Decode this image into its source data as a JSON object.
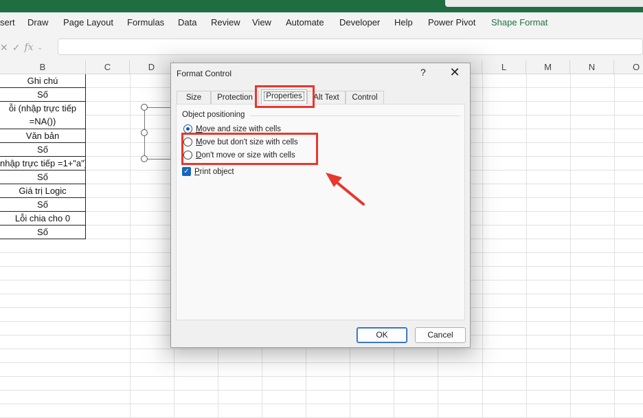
{
  "ribbon": {
    "tabs": [
      "sert",
      "Draw",
      "Page Layout",
      "Formulas",
      "Data",
      "Review",
      "View",
      "Automate",
      "Developer",
      "Help",
      "Power Pivot",
      "Shape Format"
    ]
  },
  "formula_bar": {
    "cancel_symbol": "✕",
    "enter_symbol": "✓",
    "fx_label": "fx",
    "value": ""
  },
  "grid": {
    "column_headers": [
      "B",
      "C",
      "D",
      "L",
      "M",
      "N",
      "O"
    ],
    "b_cells": [
      "Ghi chú",
      "Số",
      "ỗi (nhập trực tiếp =NA())",
      "Văn bản",
      "Số",
      "nhập trực tiếp =1+\"a\")",
      "Số",
      "Giá trị Logic",
      "Số",
      "Lỗi chia cho 0",
      "Số"
    ]
  },
  "dialog": {
    "title": "Format Control",
    "help": "?",
    "close": "✕",
    "tabs": [
      "Size",
      "Protection",
      "Properties",
      "Alt Text",
      "Control"
    ],
    "active_tab": "Properties",
    "group_label": "Object positioning",
    "options": [
      {
        "pre": "",
        "u": "M",
        "post": "ove and size with cells",
        "checked": true
      },
      {
        "pre": "",
        "u": "M",
        "post": "ove but don't size with cells",
        "checked": false
      },
      {
        "pre": "",
        "u": "D",
        "post": "on't move or size with cells",
        "checked": false
      }
    ],
    "print_object": {
      "pre": "",
      "u": "P",
      "post": "rint object",
      "checked": true
    },
    "ok_label": "OK",
    "cancel_label": "Cancel"
  },
  "colors": {
    "title_bar": "#1e6e42",
    "annotation_red": "#e8372c",
    "accent_blue": "#1565c0"
  }
}
